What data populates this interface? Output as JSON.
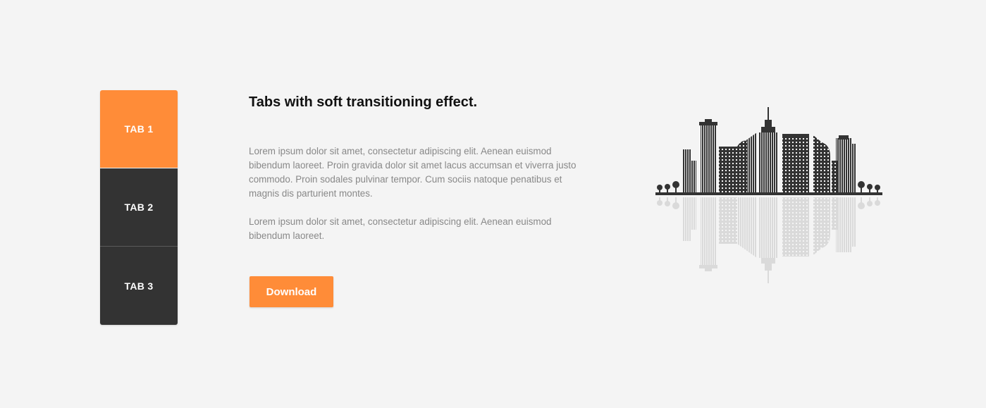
{
  "tabs": [
    {
      "label": "TAB 1",
      "active": true
    },
    {
      "label": "TAB 2",
      "active": false
    },
    {
      "label": "TAB 3",
      "active": false
    }
  ],
  "content": {
    "title": "Tabs with soft transitioning effect.",
    "paragraph1": "Lorem ipsum dolor sit amet, consectetur adipiscing elit. Aenean euismod bibendum laoreet. Proin gravida dolor sit amet lacus accumsan et viverra justo commodo. Proin sodales pulvinar tempor. Cum sociis natoque penatibus et magnis dis parturient montes.",
    "paragraph2": "Lorem ipsum dolor sit amet, consectetur adipiscing elit. Aenean euismod bibendum laoreet.",
    "download_label": "Download"
  },
  "illustration": {
    "name": "city-skyline-icon",
    "color": "#333333",
    "reflection_color": "#d9d9d9"
  },
  "colors": {
    "accent": "#ff8c38",
    "tab_dark": "#333333",
    "background": "#f4f4f4"
  }
}
